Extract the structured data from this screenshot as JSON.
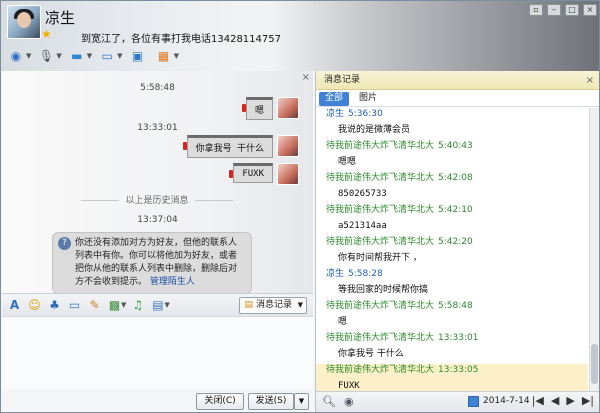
{
  "contact": {
    "name": "凉生",
    "signature": "到宽江了，各位有事打我电话13428114757"
  },
  "window_buttons": [
    "▫",
    "–",
    "□",
    "×"
  ],
  "top_toolbar": [
    {
      "icon": "camera-icon",
      "glyph": "◉"
    },
    {
      "icon": "microphone-icon",
      "glyph": "🎙"
    },
    {
      "icon": "folder-icon",
      "glyph": "▬"
    },
    {
      "icon": "remote-desktop-icon",
      "glyph": "▭"
    },
    {
      "icon": "screen-share-icon",
      "glyph": "▣"
    },
    {
      "icon": "apps-icon",
      "glyph": "▦"
    }
  ],
  "chat": {
    "messages": [
      {
        "time": "5:58:48",
        "text": "嗯"
      },
      {
        "time": "13:33:01",
        "text": "你拿我号  干什么"
      },
      {
        "time": "",
        "text": "FUXK"
      }
    ],
    "history_divider": "以上是历史消息",
    "sys_time": "13:37:04",
    "sys_text": "你还没有添加对方为好友，但他的联系人列表中有你。你可以将他加为好友，或者把你从他的联系人列表中删除，删除后对方不会收到提示。",
    "sys_link": "管理陌生人"
  },
  "input_toolbar": [
    {
      "icon": "font-icon",
      "glyph": "A"
    },
    {
      "icon": "emoji-icon",
      "glyph": "☺"
    },
    {
      "icon": "shake-icon",
      "glyph": "♣"
    },
    {
      "icon": "window-icon",
      "glyph": "▭"
    },
    {
      "icon": "edit-icon",
      "glyph": "✎"
    },
    {
      "icon": "image-icon",
      "glyph": "▩"
    },
    {
      "icon": "music-icon",
      "glyph": "♫"
    },
    {
      "icon": "screenshot-icon",
      "glyph": "▤"
    }
  ],
  "msg_log_label": "消息记录",
  "buttons": {
    "close": "关闭(C)",
    "send": "发送(S)"
  },
  "history": {
    "title": "消息记录",
    "tabs": [
      "全部",
      "图片"
    ],
    "entries": [
      {
        "sender": "凉生",
        "time": "5:36:30",
        "color": "blue",
        "text": "我说的是微薄会员",
        "mono": false,
        "hl": false
      },
      {
        "sender": "待我前途伟大炸飞清华北大",
        "time": "5:40:43",
        "color": "green",
        "text": "嗯嗯",
        "mono": false,
        "hl": false
      },
      {
        "sender": "待我前途伟大炸飞清华北大",
        "time": "5:42:08",
        "color": "green",
        "text": "850265733",
        "mono": true,
        "hl": false
      },
      {
        "sender": "待我前途伟大炸飞清华北大",
        "time": "5:42:10",
        "color": "green",
        "text": "a521314aa",
        "mono": true,
        "hl": false
      },
      {
        "sender": "待我前途伟大炸飞清华北大",
        "time": "5:42:20",
        "color": "green",
        "text": "你有时间帮我开下 ，",
        "mono": false,
        "hl": false
      },
      {
        "sender": "凉生",
        "time": "5:58:28",
        "color": "blue",
        "text": "等我回家的时候帮你搞",
        "mono": false,
        "hl": false
      },
      {
        "sender": "待我前途伟大炸飞清华北大",
        "time": "5:58:48",
        "color": "green",
        "text": "嗯",
        "mono": false,
        "hl": false
      },
      {
        "sender": "待我前途伟大炸飞清华北大",
        "time": "13:33:01",
        "color": "green",
        "text": "你拿我号  干什么",
        "mono": false,
        "hl": false
      },
      {
        "sender": "待我前途伟大炸飞清华北大",
        "time": "13:33:05",
        "color": "green",
        "text": "FUXK",
        "mono": true,
        "hl": true
      }
    ],
    "date": "2014-7-14",
    "nav": [
      "|◀",
      "◀",
      "▶",
      "▶|"
    ]
  }
}
